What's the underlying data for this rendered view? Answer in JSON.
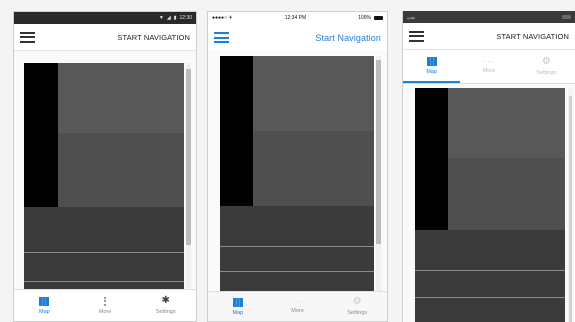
{
  "android": {
    "status": {
      "time": "12:30"
    },
    "appbar": {
      "title": "START NAVIGATION"
    },
    "tabs": [
      {
        "label": "Map",
        "icon": "map-icon",
        "active": true
      },
      {
        "label": "More",
        "icon": "more-vertical-icon",
        "active": false
      },
      {
        "label": "Settings",
        "icon": "gear-icon",
        "active": false
      }
    ]
  },
  "ios": {
    "status": {
      "carrier": "●●●●○ ✈",
      "time": "12:34 PM",
      "battery": "100%"
    },
    "appbar": {
      "title": "Start Navigation"
    },
    "tabs": [
      {
        "label": "Map",
        "icon": "map-icon",
        "active": true
      },
      {
        "label": "More",
        "icon": "more-horizontal-icon",
        "active": false
      },
      {
        "label": "Settings",
        "icon": "gear-icon",
        "active": false
      }
    ]
  },
  "windows": {
    "appbar": {
      "title": "START NAVIGATION"
    },
    "tabs": [
      {
        "label": "Map",
        "icon": "map-icon",
        "active": true
      },
      {
        "label": "More",
        "icon": "more-horizontal-icon",
        "active": false
      },
      {
        "label": "Settings",
        "icon": "gear-icon",
        "active": false
      }
    ]
  },
  "colors": {
    "accent": "#1e7fd6",
    "map_dark": "#3b3b3b",
    "map_black": "#000000",
    "map_mid": "#555555"
  }
}
